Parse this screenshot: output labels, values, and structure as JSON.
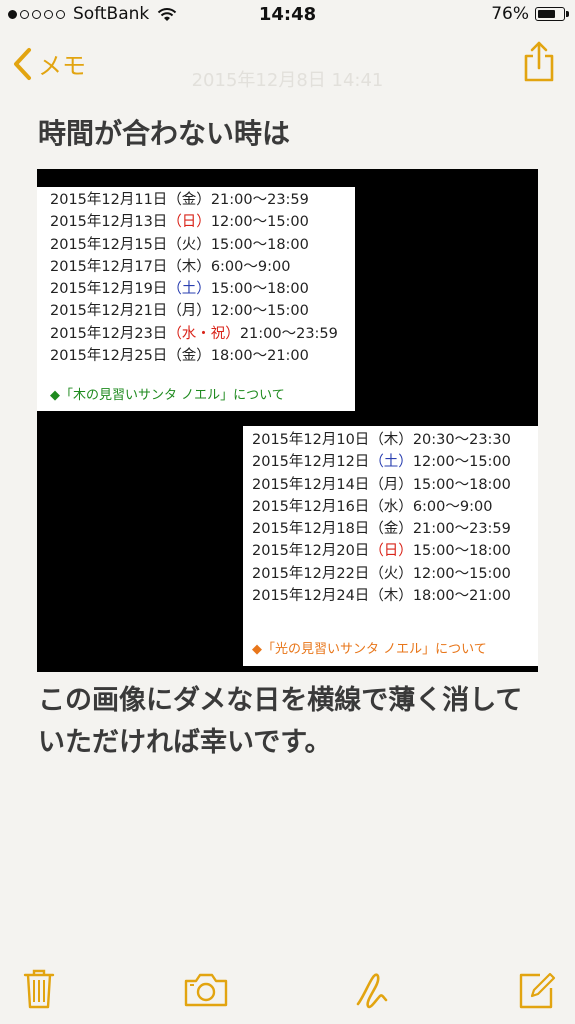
{
  "status": {
    "carrier": "SoftBank",
    "time": "14:48",
    "battery": "76%",
    "battery_level": 0.76
  },
  "nav": {
    "back_label": "メモ",
    "date": "2015年12月8日 14:41"
  },
  "note": {
    "title": "時間が合わない時は",
    "body": "この画像にダメな日を横線で薄く消していただければ幸いです。"
  },
  "image": {
    "panel1": {
      "rows": [
        {
          "date": "2015年12月11日",
          "day": "（金）",
          "time": "21:00〜23:59"
        },
        {
          "date": "2015年12月13日",
          "day": "（日）",
          "time": "12:00〜15:00"
        },
        {
          "date": "2015年12月15日",
          "day": "（火）",
          "time": "15:00〜18:00"
        },
        {
          "date": "2015年12月17日",
          "day": "（木）",
          "time": "6:00〜9:00"
        },
        {
          "date": "2015年12月19日",
          "day": "（土）",
          "time": "15:00〜18:00"
        },
        {
          "date": "2015年12月21日",
          "day": "（月）",
          "time": "12:00〜15:00"
        },
        {
          "date": "2015年12月23日",
          "day": "（水・祝）",
          "time": "21:00〜23:59"
        },
        {
          "date": "2015年12月25日",
          "day": "（金）",
          "time": "18:00〜21:00"
        }
      ],
      "link": "◆「木の見習いサンタ ノエル」について",
      "link_color": "#1e8a1e"
    },
    "panel2": {
      "rows": [
        {
          "date": "2015年12月10日",
          "day": "（木）",
          "time": "20:30〜23:30"
        },
        {
          "date": "2015年12月12日",
          "day": "（土）",
          "time": "12:00〜15:00"
        },
        {
          "date": "2015年12月14日",
          "day": "（月）",
          "time": "15:00〜18:00"
        },
        {
          "date": "2015年12月16日",
          "day": "（水）",
          "time": "6:00〜9:00"
        },
        {
          "date": "2015年12月18日",
          "day": "（金）",
          "time": "21:00〜23:59"
        },
        {
          "date": "2015年12月20日",
          "day": "（日）",
          "time": "15:00〜18:00"
        },
        {
          "date": "2015年12月22日",
          "day": "（火）",
          "time": "12:00〜15:00"
        },
        {
          "date": "2015年12月24日",
          "day": "（木）",
          "time": "18:00〜21:00"
        }
      ],
      "link": "◆「光の見習いサンタ ノエル」について",
      "link_color": "#e8761a"
    }
  },
  "toolbar": {
    "icons": [
      "trash-icon",
      "camera-icon",
      "sketch-icon",
      "compose-icon"
    ]
  },
  "colors": {
    "accent": "#e2a410",
    "background": "#f4f3f0",
    "text": "#3a3a3a"
  }
}
